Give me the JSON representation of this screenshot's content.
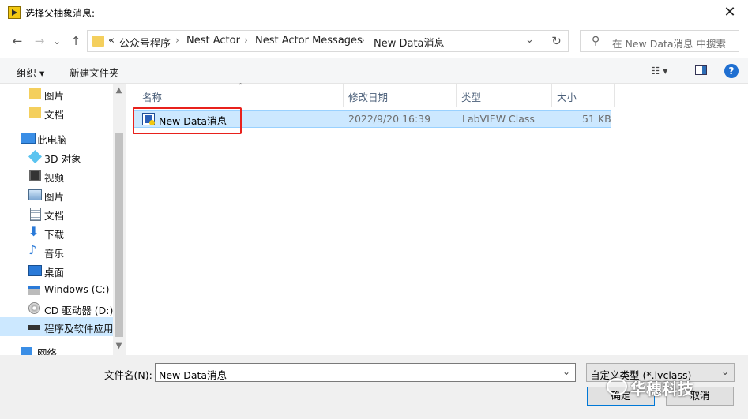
{
  "window": {
    "title": "选择父抽象消息:",
    "close_glyph": "✕"
  },
  "nav": {
    "back": "←",
    "forward": "→",
    "recent": "⌄",
    "up": "↑",
    "breadcrumb": [
      "«",
      "公众号程序",
      "Nest Actor",
      "Nest Actor Messages",
      "New Data消息"
    ],
    "crumb_sep": "›",
    "dropdown": "⌄",
    "refresh": "↻",
    "search_placeholder": "在 New Data消息 中搜索"
  },
  "toolbar": {
    "organize": "组织 ▾",
    "new_folder": "新建文件夹",
    "view": "☷ ▾",
    "help": "?"
  },
  "sidebar": {
    "items": [
      {
        "label": "图片",
        "icon": "folder-icon"
      },
      {
        "label": "文档",
        "icon": "folder-icon"
      },
      {
        "label": "此电脑",
        "icon": "computer-icon"
      },
      {
        "label": "3D 对象",
        "icon": "cube-icon"
      },
      {
        "label": "视频",
        "icon": "video-icon"
      },
      {
        "label": "图片",
        "icon": "pictures-icon"
      },
      {
        "label": "文档",
        "icon": "document-icon"
      },
      {
        "label": "下载",
        "icon": "download-icon"
      },
      {
        "label": "音乐",
        "icon": "music-icon"
      },
      {
        "label": "桌面",
        "icon": "desktop-icon"
      },
      {
        "label": "Windows  (C:)",
        "icon": "drive-icon"
      },
      {
        "label": "CD 驱动器 (D:)",
        "icon": "cd-drive-icon"
      },
      {
        "label": "程序及软件应用",
        "icon": "network-drive-icon",
        "selected": true
      },
      {
        "label": "网络",
        "icon": "network-icon"
      }
    ],
    "scroll_up": "▲",
    "scroll_down": "▼"
  },
  "filelist": {
    "sort_glyph": "⌃",
    "columns": [
      "名称",
      "修改日期",
      "类型",
      "大小"
    ],
    "rows": [
      {
        "name": "New Data消息",
        "modified": "2022/9/20 16:39",
        "type": "LabVIEW Class",
        "size": "51 KB"
      }
    ]
  },
  "bottom": {
    "filename_label": "文件名(N):",
    "filename_value": "New Data消息",
    "filetype_value": "自定义类型 (*.lvclass)",
    "ok_label": "确定",
    "cancel_label": "取消"
  },
  "watermark": {
    "text": "华穗科技"
  },
  "colors": {
    "selection": "#cce8ff",
    "highlight_box": "#e8211c",
    "accent": "#1f6fd1"
  }
}
